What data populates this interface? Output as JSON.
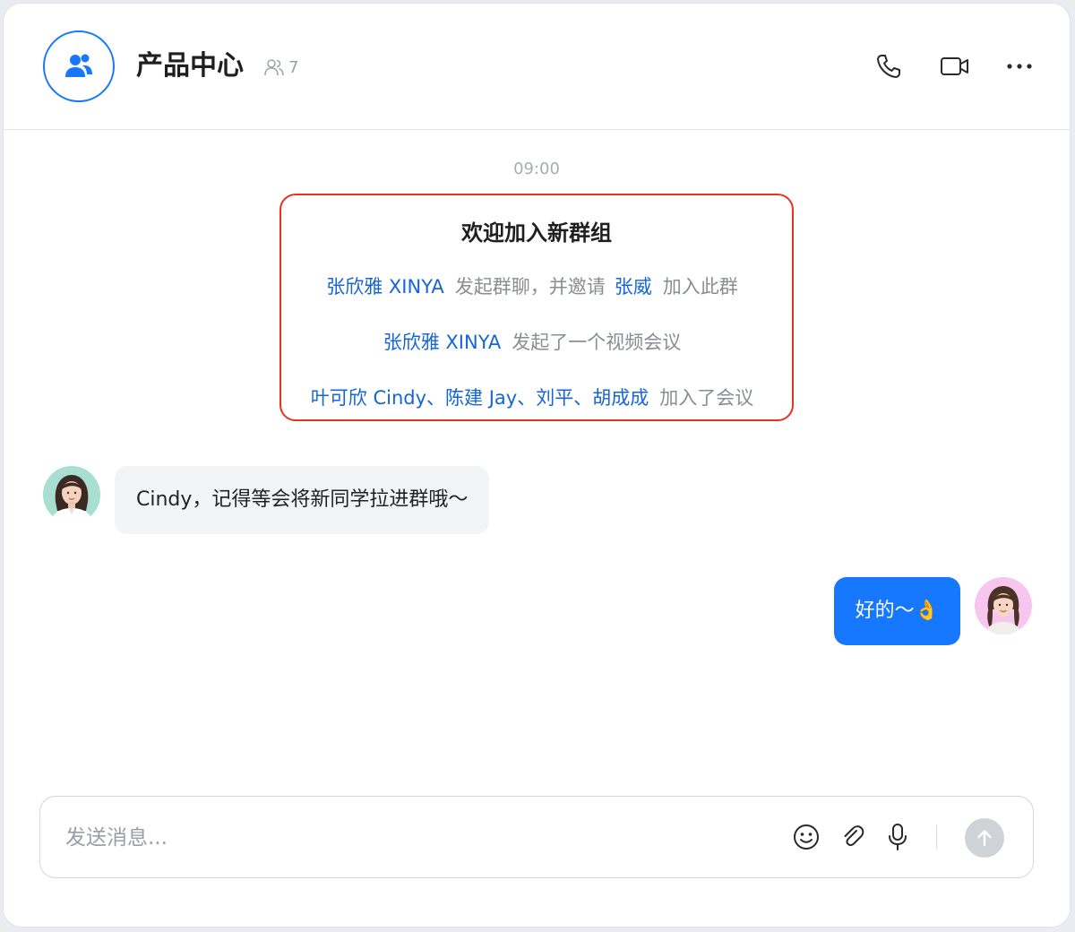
{
  "header": {
    "title": "产品中心",
    "member_count": "7",
    "icons": {
      "group": "group-users-icon",
      "members": "members-icon",
      "call": "phone-icon",
      "video": "video-camera-icon",
      "more": "more-dots-icon"
    }
  },
  "chat": {
    "timestamp": "09:00",
    "system_card": {
      "title": "欢迎加入新群组",
      "line1": {
        "name1": "张欣雅 XINYA",
        "action1": "发起群聊，并邀请",
        "name2": "张威",
        "action2": "加入此群"
      },
      "line2": {
        "name": "张欣雅 XINYA",
        "action": "发起了一个视频会议"
      },
      "line3": {
        "names": "叶可欣 Cindy、陈建 Jay、刘平、胡成成",
        "action": "加入了会议"
      }
    },
    "messages": [
      {
        "direction": "incoming",
        "text": "Cindy，记得等会将新同学拉进群哦～"
      },
      {
        "direction": "outgoing",
        "text": "好的～👌"
      }
    ]
  },
  "composer": {
    "placeholder": "发送消息...",
    "icons": {
      "emoji": "emoji-icon",
      "attach": "paperclip-icon",
      "voice": "microphone-icon",
      "send": "send-arrow-up-icon"
    }
  },
  "colors": {
    "accent": "#1677ff",
    "name_link": "#1565d8",
    "card_border": "#e4341d"
  }
}
